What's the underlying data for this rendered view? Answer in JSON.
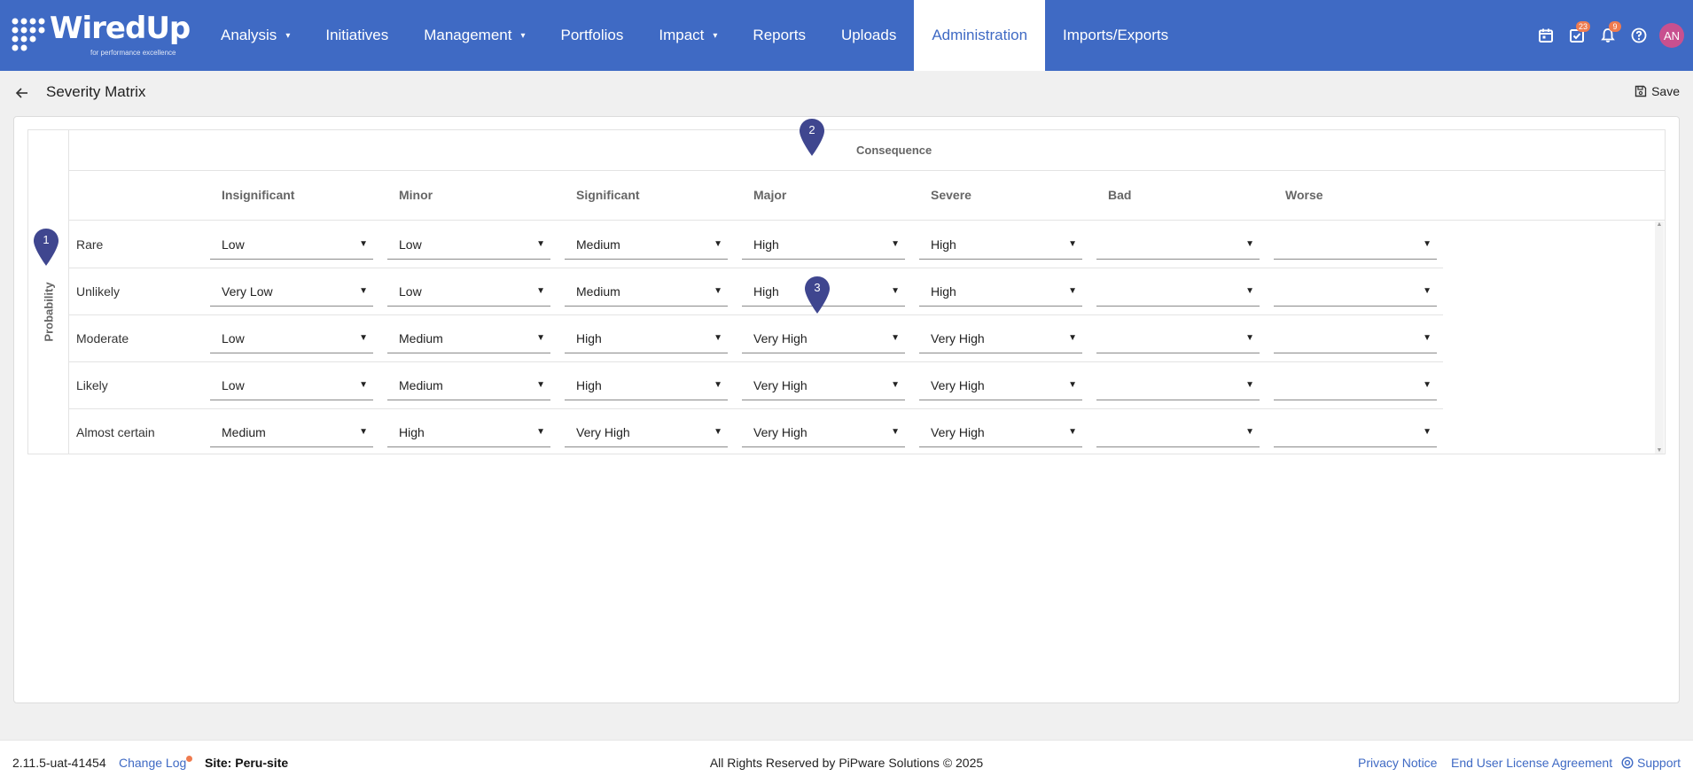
{
  "brand": {
    "name": "WiredUp",
    "tagline": "for performance excellence"
  },
  "nav": {
    "items": [
      {
        "label": "Analysis",
        "caret": "▾"
      },
      {
        "label": "Initiatives",
        "caret": ""
      },
      {
        "label": "Management",
        "caret": "▾"
      },
      {
        "label": "Portfolios",
        "caret": ""
      },
      {
        "label": "Impact",
        "caret": "▾"
      },
      {
        "label": "Reports",
        "caret": ""
      },
      {
        "label": "Uploads",
        "caret": ""
      },
      {
        "label": "Administration",
        "caret": "",
        "active": true
      },
      {
        "label": "Imports/Exports",
        "caret": ""
      }
    ]
  },
  "header_icons": {
    "calendar": "calendar-icon",
    "tasks": {
      "icon": "task-check-icon",
      "badge": "23"
    },
    "notifications": {
      "icon": "bell-icon",
      "badge": "9"
    },
    "help": "help-icon",
    "avatar": "AN"
  },
  "page": {
    "title": "Severity Matrix",
    "save_label": "Save"
  },
  "matrix": {
    "consequence_label": "Consequence",
    "probability_label": "Probability",
    "columns": [
      "Insignificant",
      "Minor",
      "Significant",
      "Major",
      "Severe",
      "Bad",
      "Worse"
    ],
    "rows": [
      {
        "label": "Rare",
        "values": [
          "Low",
          "Low",
          "Medium",
          "High",
          "High",
          "",
          ""
        ]
      },
      {
        "label": "Unlikely",
        "values": [
          "Very Low",
          "Low",
          "Medium",
          "High",
          "High",
          "",
          ""
        ]
      },
      {
        "label": "Moderate",
        "values": [
          "Low",
          "Medium",
          "High",
          "Very High",
          "Very High",
          "",
          ""
        ]
      },
      {
        "label": "Likely",
        "values": [
          "Low",
          "Medium",
          "High",
          "Very High",
          "Very High",
          "",
          ""
        ]
      },
      {
        "label": "Almost certain",
        "values": [
          "Medium",
          "High",
          "Very High",
          "Very High",
          "Very High",
          "",
          ""
        ]
      }
    ]
  },
  "markers": [
    "1",
    "2",
    "3"
  ],
  "footer": {
    "version": "2.11.5-uat-41454",
    "changelog": "Change Log",
    "site": "Site: Peru-site",
    "copyright": "All Rights Reserved by PiPware Solutions © 2025",
    "privacy": "Privacy Notice",
    "eula": "End User License Agreement",
    "support": "Support"
  },
  "colors": {
    "primary": "#3f6ac4",
    "marker": "#3f468f",
    "badge": "#ef7b4f",
    "avatar": "#c8508f"
  }
}
